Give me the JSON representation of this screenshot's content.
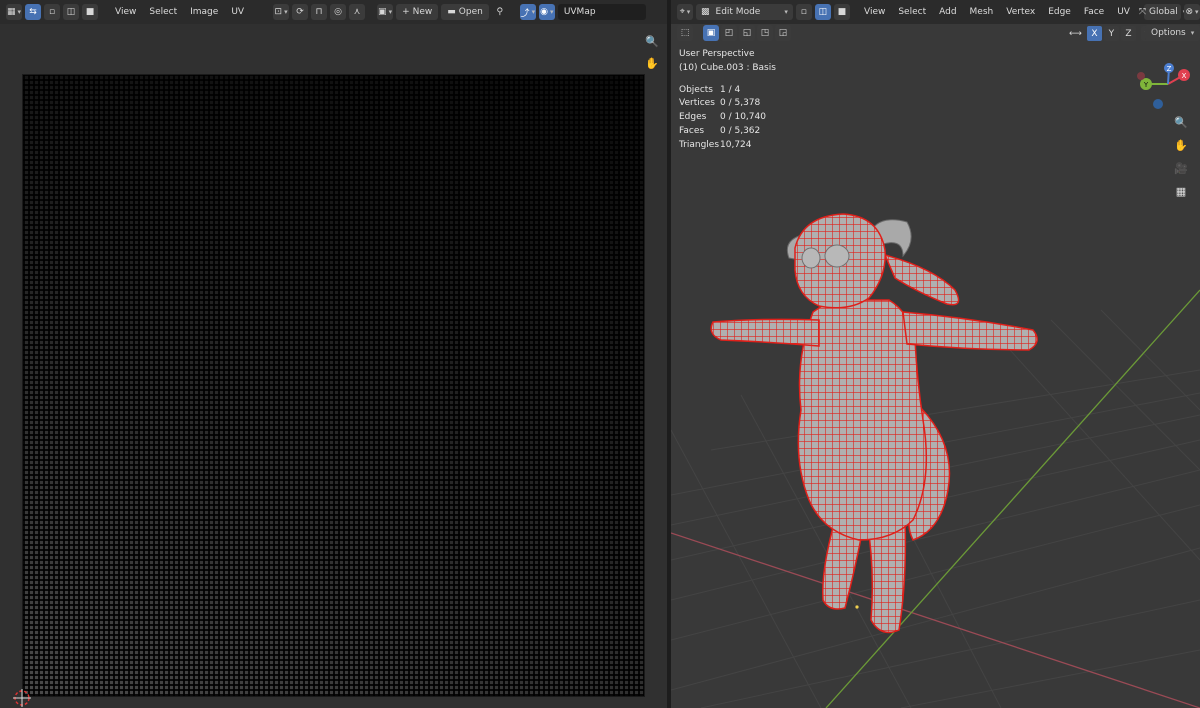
{
  "uv_editor": {
    "menus": [
      "View",
      "Select",
      "Image",
      "UV"
    ],
    "new_label": "New",
    "open_label": "Open",
    "uvmap_name": "UVMap"
  },
  "viewport": {
    "mode": "Edit Mode",
    "menus": [
      "View",
      "Select",
      "Add",
      "Mesh",
      "Vertex",
      "Edge",
      "Face",
      "UV"
    ],
    "transform_orientation": "Global",
    "options_label": "Options",
    "axes": [
      "X",
      "Y",
      "Z"
    ],
    "overlay": {
      "view_name": "User Perspective",
      "object_info": "(10) Cube.003 : Basis",
      "stats": [
        {
          "label": "Objects",
          "value": "1 / 4"
        },
        {
          "label": "Vertices",
          "value": "0 / 5,378"
        },
        {
          "label": "Edges",
          "value": "0 / 10,740"
        },
        {
          "label": "Faces",
          "value": "0 / 5,362"
        },
        {
          "label": "Triangles",
          "value": "10,724"
        }
      ]
    },
    "gizmo": {
      "x": "X",
      "y": "Y",
      "z": "Z"
    },
    "colors": {
      "wire": "#e0201a",
      "mesh": "#a9a9a9",
      "x_axis": "#e04050",
      "y_axis": "#7fb53a",
      "z_axis": "#4d7fd1"
    }
  }
}
